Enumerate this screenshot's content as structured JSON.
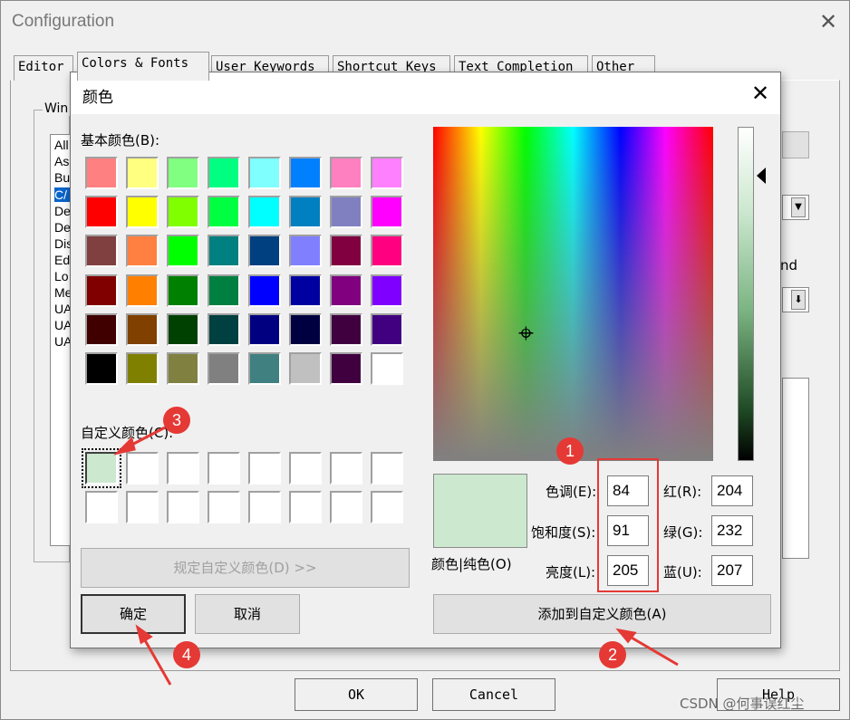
{
  "config": {
    "title": "Configuration",
    "close_glyph": "✕",
    "tabs": [
      {
        "label": "Editor"
      },
      {
        "label": "Colors & Fonts"
      },
      {
        "label": "User Keywords"
      },
      {
        "label": "Shortcut Keys"
      },
      {
        "label": "Text Completion"
      },
      {
        "label": "Other"
      }
    ],
    "group_label": "Win",
    "list_items": [
      "All",
      "As",
      "Bu",
      "C/",
      "De",
      "De",
      "Dis",
      "Ed",
      "Lo",
      "Me",
      "UA",
      "UA",
      "UA"
    ],
    "right_partial_text": "nd",
    "buttons": {
      "ok": "OK",
      "cancel": "Cancel",
      "help": "Help"
    }
  },
  "dialog": {
    "title": "颜色",
    "close_glyph": "✕",
    "basic_colors_label": "基本颜色(B):",
    "basic_colors": [
      "#ff8080",
      "#ffff80",
      "#80ff80",
      "#00ff80",
      "#80ffff",
      "#0080ff",
      "#ff80c0",
      "#ff80ff",
      "#ff0000",
      "#ffff00",
      "#80ff00",
      "#00ff40",
      "#00ffff",
      "#0080c0",
      "#8080c0",
      "#ff00ff",
      "#804040",
      "#ff8040",
      "#00ff00",
      "#008080",
      "#004080",
      "#8080ff",
      "#800040",
      "#ff0080",
      "#800000",
      "#ff8000",
      "#008000",
      "#008040",
      "#0000ff",
      "#0000a0",
      "#800080",
      "#8000ff",
      "#400000",
      "#804000",
      "#004000",
      "#004040",
      "#000080",
      "#000040",
      "#400040",
      "#400080",
      "#000000",
      "#808000",
      "#808040",
      "#808080",
      "#408080",
      "#c0c0c0",
      "#400040",
      "#ffffff"
    ],
    "custom_colors_label": "自定义颜色(C):",
    "custom_colors": [
      "#cce8cf",
      "#ffffff",
      "#ffffff",
      "#ffffff",
      "#ffffff",
      "#ffffff",
      "#ffffff",
      "#ffffff",
      "#ffffff",
      "#ffffff",
      "#ffffff",
      "#ffffff",
      "#ffffff",
      "#ffffff",
      "#ffffff",
      "#ffffff"
    ],
    "define_custom_button": "规定自定义颜色(D) >>",
    "ok_button": "确定",
    "cancel_button": "取消",
    "preview_label": "颜色|纯色(O)",
    "preview_color": "#cce8cf",
    "hue_label": "色调(E):",
    "hue": "84",
    "sat_label": "饱和度(S):",
    "sat": "91",
    "lum_label": "亮度(L):",
    "lum": "205",
    "red_label": "红(R):",
    "red": "204",
    "green_label": "绿(G):",
    "green": "232",
    "blue_label": "蓝(U):",
    "blue": "207",
    "add_custom_button": "添加到自定义颜色(A)",
    "crosshair_glyph": "⌖"
  },
  "annotations": {
    "badges": [
      "1",
      "2",
      "3",
      "4"
    ],
    "accent": "#e53935"
  },
  "watermark": "CSDN @何事误红尘"
}
